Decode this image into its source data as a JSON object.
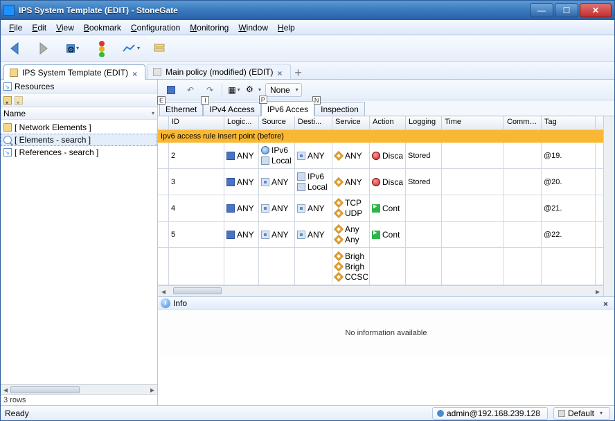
{
  "window": {
    "title": "IPS System Template (EDIT) - StoneGate"
  },
  "menubar": [
    "File",
    "Edit",
    "View",
    "Bookmark",
    "Configuration",
    "Monitoring",
    "Window",
    "Help"
  ],
  "doc_tabs": [
    {
      "label": "IPS System Template (EDIT)",
      "active": true
    },
    {
      "label": "Main policy (modified) (EDIT)",
      "active": false
    }
  ],
  "sidebar": {
    "header": "Resources",
    "col": "Name",
    "items": [
      {
        "label": "[ Network Elements ]",
        "icon": "folder"
      },
      {
        "label": "[ Elements - search ]",
        "icon": "search",
        "selected": true
      },
      {
        "label": "[ References - search ]",
        "icon": "ref"
      }
    ],
    "rows_label": "3 rows"
  },
  "main": {
    "none_label": "None",
    "tabs": [
      {
        "label": "Ethernet",
        "key": "E"
      },
      {
        "label": "IPv4 Access",
        "key": "I"
      },
      {
        "label": "IPv6 Acces",
        "key": "P",
        "active": true
      },
      {
        "label": "Inspection",
        "key": "N"
      }
    ],
    "columns": [
      "ID",
      "Logic...",
      "Source",
      "Desti...",
      "Service",
      "Action",
      "Logging",
      "Time",
      "Comment",
      "Tag"
    ],
    "insert_row": "Ipv6 access rule insert point (before)",
    "rows": [
      {
        "id": "2",
        "logic": "ANY",
        "src": [
          {
            "t": "IPv6",
            "i": "globe"
          },
          {
            "t": "Local",
            "i": "host"
          }
        ],
        "dst": [
          {
            "t": "ANY",
            "i": "net"
          }
        ],
        "svc": [
          {
            "t": "ANY",
            "i": "svc"
          }
        ],
        "act": {
          "t": "Disca",
          "i": "disc"
        },
        "log": "Stored",
        "tag": "@19."
      },
      {
        "id": "3",
        "logic": "ANY",
        "src": [
          {
            "t": "ANY",
            "i": "net"
          }
        ],
        "dst": [
          {
            "t": "IPv6",
            "i": "host"
          },
          {
            "t": "Local",
            "i": "host"
          }
        ],
        "svc": [
          {
            "t": "ANY",
            "i": "svc"
          }
        ],
        "act": {
          "t": "Disca",
          "i": "disc"
        },
        "log": "Stored",
        "tag": "@20."
      },
      {
        "id": "4",
        "logic": "ANY",
        "src": [
          {
            "t": "ANY",
            "i": "net"
          }
        ],
        "dst": [
          {
            "t": "ANY",
            "i": "net"
          }
        ],
        "svc": [
          {
            "t": "TCP",
            "i": "svc"
          },
          {
            "t": "UDP",
            "i": "svc"
          }
        ],
        "act": {
          "t": "Cont",
          "i": "cont"
        },
        "log": "",
        "tag": "@21."
      },
      {
        "id": "5",
        "logic": "ANY",
        "src": [
          {
            "t": "ANY",
            "i": "net"
          }
        ],
        "dst": [
          {
            "t": "ANY",
            "i": "net"
          }
        ],
        "svc": [
          {
            "t": "Any",
            "i": "svc"
          },
          {
            "t": "Any",
            "i": "svc"
          }
        ],
        "act": {
          "t": "Cont",
          "i": "cont"
        },
        "log": "",
        "tag": "@22."
      },
      {
        "id": "",
        "logic": "",
        "src": [],
        "dst": [],
        "svc": [
          {
            "t": "Brigh",
            "i": "svc"
          },
          {
            "t": "Brigh",
            "i": "svc"
          },
          {
            "t": "CCSC",
            "i": "svc"
          }
        ],
        "act": null,
        "log": "",
        "tag": ""
      }
    ]
  },
  "info": {
    "title": "Info",
    "body": "No information available"
  },
  "status": {
    "ready": "Ready",
    "user": "admin@192.168.239.128",
    "profile": "Default"
  }
}
